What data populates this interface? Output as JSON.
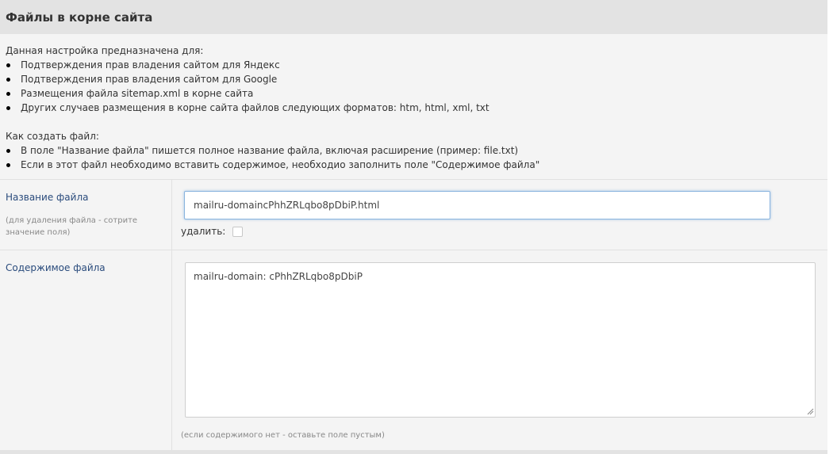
{
  "header": {
    "title": "Файлы в корне сайта"
  },
  "description": {
    "intro": "Данная настройка предназначена для:",
    "purposes": [
      "Подтверждения прав владения сайтом для Яндекс",
      "Подтверждения прав владения сайтом для Google",
      "Размещения файла sitemap.xml в корне сайта",
      "Других случаев размещения в корне сайта файлов следующих форматов: htm, html, xml, txt"
    ],
    "howto_title": "Как создать файл:",
    "howto": [
      "В поле \"Название файла\" пишется полное название файла, включая расширение (пример: file.txt)",
      "Если в этот файл необходимо вставить содержимое, необходио заполнить поле \"Содержимое файла\""
    ]
  },
  "filename_field": {
    "label": "Название файла",
    "hint": "(для удаления файла - сотрите значение поля)",
    "value": "mailru-domaincPhhZRLqbo8pDbiP.html",
    "delete_label": "удалить:",
    "delete_checked": false
  },
  "content_field": {
    "label": "Содержимое файла",
    "value": "mailru-domain: cPhhZRLqbo8pDbiP",
    "hint": "(если содержимого нет - оставьте поле пустым)"
  },
  "colors": {
    "header_bg": "#e3e3e3",
    "panel_bg": "#f4f4f4",
    "label_color": "#2a4b7c",
    "focus_border": "#8ab4de"
  }
}
